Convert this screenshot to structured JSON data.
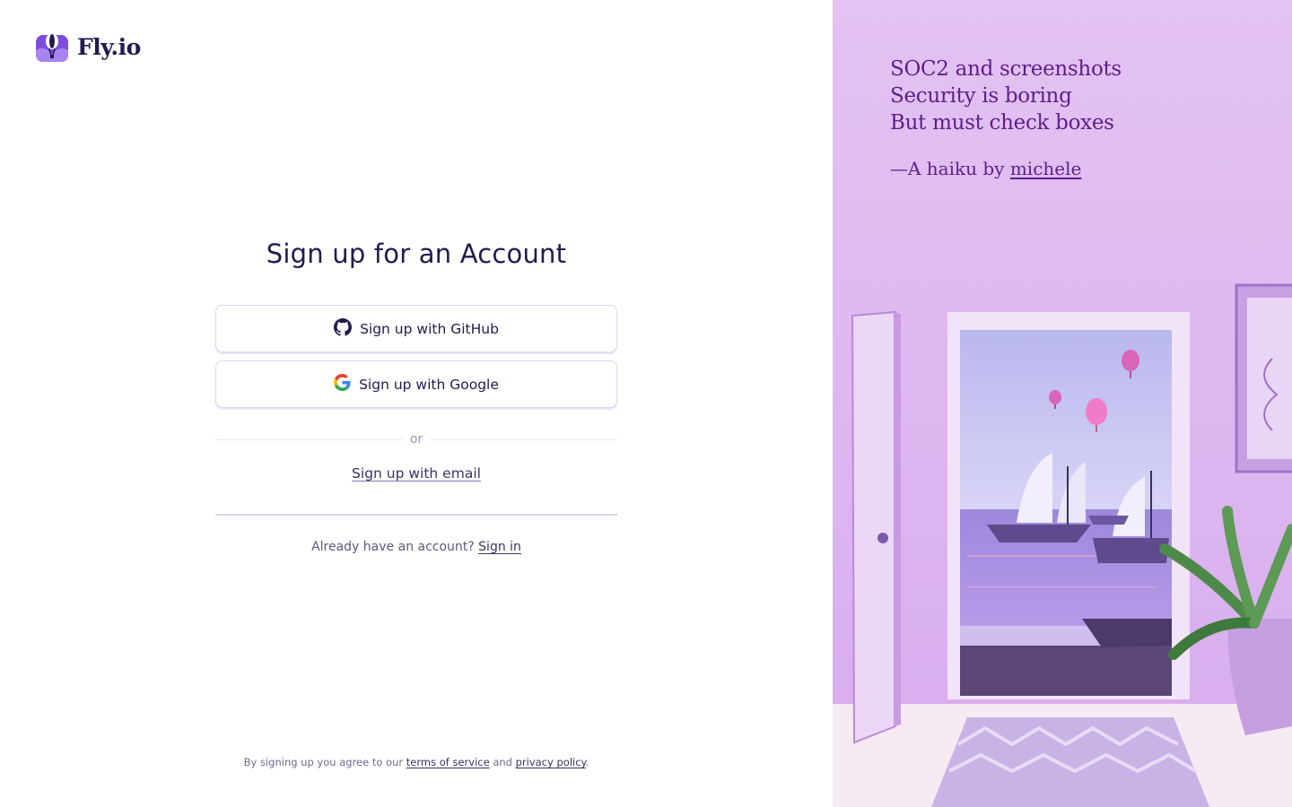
{
  "brand": {
    "name": "Fly.io"
  },
  "form": {
    "title": "Sign up for an Account",
    "github_label": "Sign up with GitHub",
    "google_label": "Sign up with Google",
    "divider_text": "or",
    "email_link": "Sign up with email",
    "already_text": "Already have an account?",
    "sign_in_link": "Sign in"
  },
  "footer": {
    "prefix": "By signing up you agree to our",
    "terms_link": "terms of service",
    "and": "and",
    "privacy_link": "privacy policy",
    "suffix": "."
  },
  "haiku": {
    "lines": [
      "SOC2 and screenshots",
      "Security is boring",
      "But must check boxes"
    ],
    "credit_prefix": "—A haiku by",
    "author": "michele"
  },
  "colors": {
    "brand_purple": "#7c4ddc",
    "text_dark": "#241a4f",
    "panel_bg": "#e1bdf0",
    "haiku_text": "#5b1f8c"
  },
  "icons": [
    "fly-logo-icon",
    "github-icon",
    "google-icon"
  ]
}
